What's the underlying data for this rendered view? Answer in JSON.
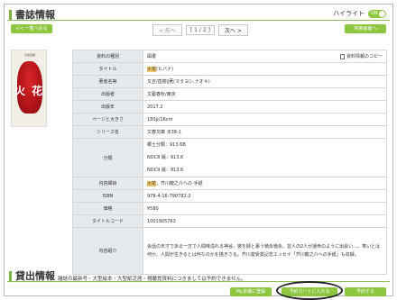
{
  "header": {
    "title": "書誌情報",
    "highlight_label": "ハイライト",
    "toggle_label": "ON",
    "back_button": "<< 一覧へ戻る",
    "search_button": "検索画面へ"
  },
  "pager": {
    "prev": "< 前へ",
    "count": "[ 1 / 2 ]",
    "next": "次へ >"
  },
  "cover": {
    "author": "又吉直樹",
    "title_left": "火",
    "title_right": "花"
  },
  "copy_link": "資料情報のコピー",
  "record": {
    "material_type_label": "資料の種別",
    "material_type": "図書",
    "title_label": "タイトル",
    "title_hl": "火花",
    "title_rest": "(ヒバナ)",
    "author_label": "著者名等",
    "author": "又吉/直樹∥著(マタヨシ,ナオキ)",
    "publisher_label": "出版者",
    "publisher": "文藝春秋/東京",
    "year_label": "出版年",
    "year": "2017.2",
    "pages_label": "ページと大きさ",
    "pages": "180p/16cm",
    "series_label": "シリーズ名",
    "series": "文春文庫 ま38-1",
    "class_label": "分類",
    "class1": "郷土分類：913.6B",
    "class2": "NDC8 版：913.6",
    "class3": "NDC9 版：913.6",
    "contents_label": "内容細目",
    "contents_hl": "火花",
    "contents_rest": "；芥川龍之介への 手紙",
    "isbn_label": "ISBN",
    "isbn": "978-4-16-790782-2",
    "price_label": "価格",
    "price": "¥580",
    "code_label": "タイトルコード",
    "code": "1001905763",
    "desc_label": "内容紹介",
    "desc": "会話の天才である一方で人間味溢れる神谷。彼を師と慕う徳永徳永。芸人の2人が運命のように出会い…。笑いとは何か、人間が生きるとは何なのかを描きさる。芥川賞受賞記念エッセイ「芥川龍之介への手紙」も収録。"
  },
  "lending": {
    "title": "貸出情報",
    "note": "雑誌の最新号・大型絵本・大型紙芝居・視聴覚資料につきましては予約できません。",
    "mybook_button": "My本棚に登録",
    "cart_button": "予約カートに入れる",
    "reserve_button": "予約する"
  }
}
